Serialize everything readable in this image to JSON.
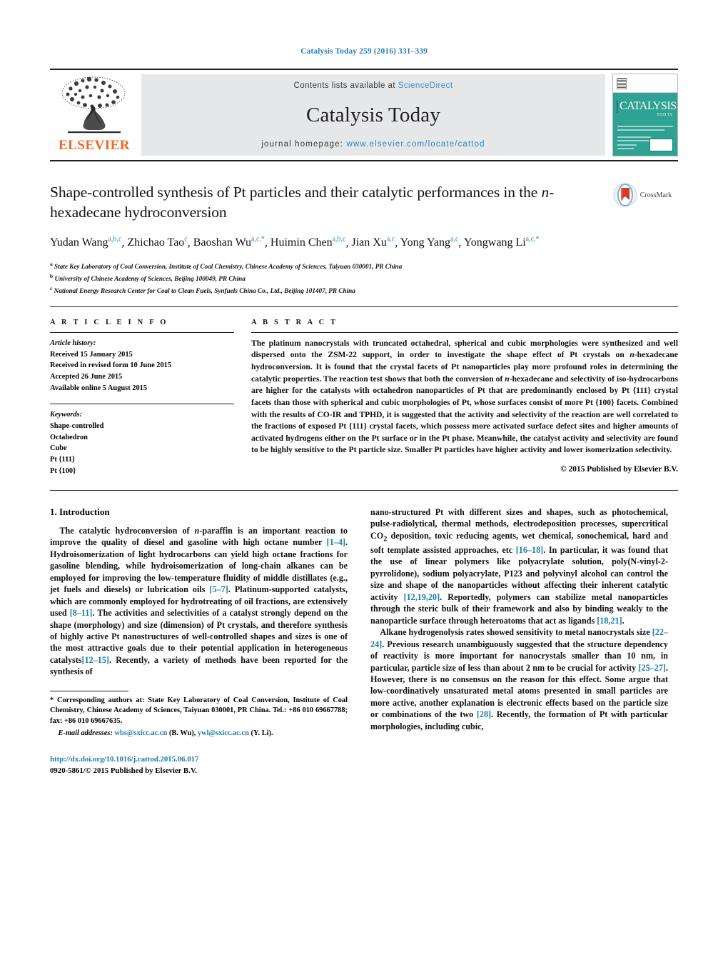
{
  "running_head": "Catalysis Today 259 (2016) 331–339",
  "masthead": {
    "publisher_name": "ELSEVIER",
    "contents_prefix": "Contents lists available at",
    "contents_link": "ScienceDirect",
    "journal_title": "Catalysis Today",
    "homepage_prefix": "journal homepage:",
    "homepage_url": "www.elsevier.com/locate/cattod",
    "cover_title": "CATALYSIS",
    "cover_subtitle": "TODAY"
  },
  "article": {
    "title": "Shape-controlled synthesis of Pt particles and their catalytic performances in the n-hexadecane hydroconversion",
    "crossmark_label": "CrossMark",
    "authors_line1": "Yudan Wang",
    "authors": [
      {
        "name": "Yudan Wang",
        "sup": "a,b,c"
      },
      {
        "name": "Zhichao Tao",
        "sup": "c"
      },
      {
        "name": "Baoshan Wu",
        "sup": "a,c,*"
      },
      {
        "name": "Huimin Chen",
        "sup": "a,b,c"
      },
      {
        "name": "Jian Xu",
        "sup": "a,c"
      },
      {
        "name": "Yong Yang",
        "sup": "a,c"
      },
      {
        "name": "Yongwang Li",
        "sup": "a,c,*"
      }
    ],
    "affiliations": [
      {
        "marker": "a",
        "text": "State Key Laboratory of Coal Conversion, Institute of Coal Chemistry, Chinese Academy of Sciences, Taiyuan 030001, PR China"
      },
      {
        "marker": "b",
        "text": "University of Chinese Academy of Sciences, Beijing 100049, PR China"
      },
      {
        "marker": "c",
        "text": "National Energy Research Center for Coal to Clean Fuels, Synfuels China Co., Ltd., Beijing 101407, PR China"
      }
    ]
  },
  "info": {
    "heading": "A R T I C L E   I N F O",
    "history_label": "Article history:",
    "history": [
      "Received 15 January 2015",
      "Received in revised form 10 June 2015",
      "Accepted 26 June 2015",
      "Available online 5 August 2015"
    ],
    "keywords_label": "Keywords:",
    "keywords": [
      "Shape-controlled",
      "Octahedron",
      "Cube",
      "Pt {111}",
      "Pt {100}"
    ]
  },
  "abstract": {
    "heading": "A B S T R A C T",
    "text": "The platinum nanocrystals with truncated octahedral, spherical and cubic morphologies were synthesized and well dispersed onto the ZSM-22 support, in order to investigate the shape effect of Pt crystals on n-hexadecane hydroconversion. It is found that the crystal facets of Pt nanoparticles play more profound roles in determining the catalytic properties. The reaction test shows that both the conversion of n-hexadecane and selectivity of iso-hydrocarbons are higher for the catalysts with octahedron nanoparticles of Pt that are predominantly enclosed by Pt {111} crystal facets than those with spherical and cubic morphologies of Pt, whose surfaces consist of more Pt {100} facets. Combined with the results of CO-IR and TPHD, it is suggested that the activity and selectivity of the reaction are well correlated to the fractions of exposed Pt {111} crystal facets, which possess more activated surface defect sites and higher amounts of activated hydrogens either on the Pt surface or in the Pt phase. Meanwhile, the catalyst activity and selectivity are found to be highly sensitive to the Pt particle size. Smaller Pt particles have higher activity and lower isomerization selectivity.",
    "copyright": "© 2015 Published by Elsevier B.V."
  },
  "body": {
    "section_heading": "1.  Introduction",
    "left_paragraph_1": "The catalytic hydroconversion of n-paraffin is an important reaction to improve the quality of diesel and gasoline with high octane number [1–4]. Hydroisomerization of light hydrocarbons can yield high octane fractions for gasoline blending, while hydroisomerization of long-chain alkanes can be employed for improving the low-temperature fluidity of middle distillates (e.g., jet fuels and diesels) or lubrication oils [5–7]. Platinum-supported catalysts, which are commonly employed for hydrotreating of oil fractions, are extensively used [8–11]. The activities and selectivities of a catalyst strongly depend on the shape (morphology) and size (dimension) of Pt crystals, and therefore synthesis of highly active Pt nanostructures of well-controlled shapes and sizes is one of the most attractive goals due to their potential application in heterogeneous catalysts[12–15]. Recently, a variety of methods have been reported for the synthesis of",
    "right_paragraph_1": "nano-structured Pt with different sizes and shapes, such as photochemical, pulse-radiolytical, thermal methods, electrodeposition processes, supercritical CO2 deposition, toxic reducing agents, wet chemical, sonochemical, hard and soft template assisted approaches, etc [16–18]. In particular, it was found that the use of linear polymers like polyacrylate solution, poly(N-vinyl-2-pyrrolidone), sodium polyacrylate, P123 and polyvinyl alcohol can control the size and shape of the nanoparticles without affecting their inherent catalytic activity [12,19,20]. Reportedly, polymers can stabilize metal nanoparticles through the steric bulk of their framework and also by binding weakly to the nanoparticle surface through heteroatoms that act as ligands [18,21].",
    "right_paragraph_2": "Alkane hydrogenolysis rates showed sensitivity to metal nanocrystals size [22–24]. Previous research unambiguously suggested that the structure dependency of reactivity is more important for nanocrystals smaller than 10 nm, in particular, particle size of less than about 2 nm to be crucial for activity [25–27]. However, there is no consensus on the reason for this effect. Some argue that low-coordinatively unsaturated metal atoms presented in small particles are more active, another explanation is electronic effects based on the particle size or combinations of the two [28]. Recently, the formation of Pt with particular morphologies, including cubic,"
  },
  "footnote": {
    "corresponding": "*  Corresponding authors at: State Key Laboratory of Coal Conversion, Institute of Coal Chemistry, Chinese Academy of Sciences, Taiyuan 030001, PR China. Tel.: +86 010 69667788; fax: +86 010 69667635.",
    "email_label": "E-mail addresses:",
    "email_1": "wbs@sxicc.ac.cn",
    "email_1_owner": "(B. Wu),",
    "email_2": "ywl@sxicc.ac.cn",
    "email_2_owner": "(Y. Li)."
  },
  "doi_block": {
    "doi_url": "http://dx.doi.org/10.1016/j.cattod.2015.06.017",
    "issn_line": "0920-5861/© 2015 Published by Elsevier B.V."
  },
  "colors": {
    "link_blue": "#1b7ab0",
    "header_blue": "#2a7fb8",
    "elsevier_orange": "#f26522",
    "masthead_grey": "#e6e7e8",
    "cover_teal": "#2fa293"
  }
}
